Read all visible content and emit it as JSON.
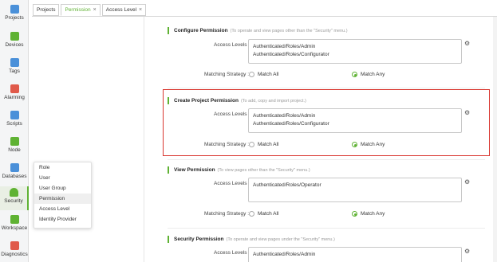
{
  "nav": {
    "items": [
      {
        "label": "Projects",
        "icon": "projects-icon",
        "color": "#4a90d9"
      },
      {
        "label": "Devices",
        "icon": "devices-icon",
        "color": "#5fb233"
      },
      {
        "label": "Tags",
        "icon": "tags-icon",
        "color": "#4a90d9"
      },
      {
        "label": "Alarming",
        "icon": "alarming-icon",
        "color": "#e05a4a"
      },
      {
        "label": "Scripts",
        "icon": "scripts-icon",
        "color": "#4a90d9"
      },
      {
        "label": "Node",
        "icon": "node-icon",
        "color": "#5fb233"
      },
      {
        "label": "Databases",
        "icon": "databases-icon",
        "color": "#4a90d9"
      },
      {
        "label": "Security",
        "icon": "security-icon",
        "color": "#5fb233"
      },
      {
        "label": "Workspace",
        "icon": "workspace-icon",
        "color": "#5fb233"
      },
      {
        "label": "Diagnostics",
        "icon": "diagnostics-icon",
        "color": "#e05a4a"
      }
    ]
  },
  "tabs": [
    {
      "label": "Projects"
    },
    {
      "label": "Permission"
    },
    {
      "label": "Access Level"
    }
  ],
  "security_menu": [
    "Role",
    "User",
    "User Group",
    "Permission",
    "Access Level",
    "Identity Provider"
  ],
  "labels": {
    "access_levels": "Access Levels :",
    "matching_strategy": "Matching Strategy :",
    "match_all": "Match All",
    "match_any": "Match Any"
  },
  "cards": [
    {
      "title": "Configure Permission",
      "desc": "(To operate and view pages other than the \"Security\" menu.)",
      "levels": "Authenticated/Roles/Admin\nAuthenticated/Roles/Configurator",
      "strategy": "Match Any"
    },
    {
      "title": "Create Project Permission",
      "desc": "(To add, copy and import project.)",
      "levels": "Authenticated/Roles/Admin\nAuthenticated/Roles/Configurator",
      "strategy": "Match Any"
    },
    {
      "title": "View Permission",
      "desc": "(To view pages other than the \"Security\" menu.)",
      "levels": "Authenticated/Roles/Operator",
      "strategy": "Match Any"
    },
    {
      "title": "Security Permission",
      "desc": "(To operate and view pages under the \"Security\" menu.)",
      "levels": "Authenticated/Roles/Admin",
      "strategy": ""
    }
  ],
  "colors": {
    "accent": "#5fb233",
    "highlight": "#d9362f"
  }
}
